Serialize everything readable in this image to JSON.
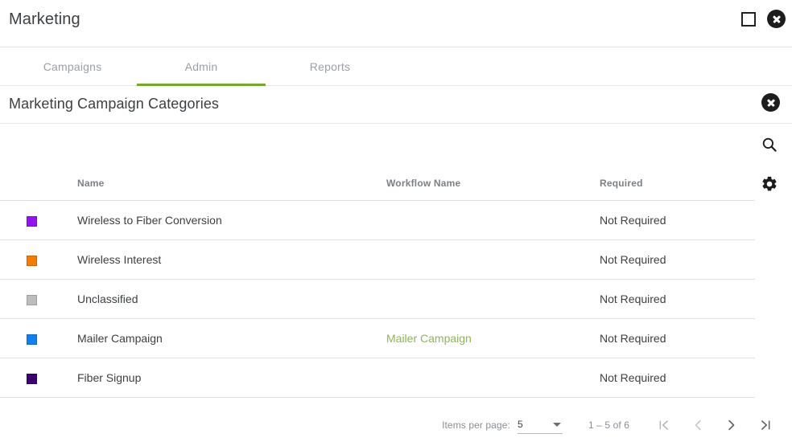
{
  "window": {
    "title": "Marketing",
    "maximize_icon": "square-maximize-icon",
    "close_icon": "circle-close-icon"
  },
  "tabs": [
    {
      "label": "Campaigns",
      "active": false
    },
    {
      "label": "Admin",
      "active": true
    },
    {
      "label": "Reports",
      "active": false
    }
  ],
  "section": {
    "title": "Marketing Campaign Categories",
    "close_icon": "circle-close-icon"
  },
  "side_actions": [
    {
      "name": "search-icon",
      "label": "Search"
    },
    {
      "name": "gear-icon",
      "label": "Settings"
    }
  ],
  "table": {
    "columns": [
      "",
      "Name",
      "Workflow Name",
      "Required"
    ],
    "rows": [
      {
        "color": "#9810f7",
        "name": "Wireless to Fiber Conversion",
        "workflow": "",
        "required": "Not Required"
      },
      {
        "color": "#f57c00",
        "name": "Wireless Interest",
        "workflow": "",
        "required": "Not Required"
      },
      {
        "color": "#bdbdbd",
        "name": "Unclassified",
        "workflow": "",
        "required": "Not Required"
      },
      {
        "color": "#0d80f2",
        "name": "Mailer Campaign",
        "workflow": "Mailer Campaign",
        "required": "Not Required"
      },
      {
        "color": "#3b0070",
        "name": "Fiber Signup",
        "workflow": "",
        "required": "Not Required"
      }
    ]
  },
  "paginator": {
    "items_per_page_label": "Items per page:",
    "items_per_page_value": "5",
    "range_label": "1 – 5 of 6",
    "first_page_icon": "first-page-icon",
    "previous_page_icon": "previous-page-icon",
    "next_page_icon": "next-page-icon",
    "last_page_icon": "last-page-icon"
  },
  "colors": {
    "accent_green": "#76a82b",
    "link_green": "#8cb84e",
    "text_primary": "#3d4043",
    "text_muted": "#9aa0a6",
    "divider": "#e0e0e0"
  }
}
